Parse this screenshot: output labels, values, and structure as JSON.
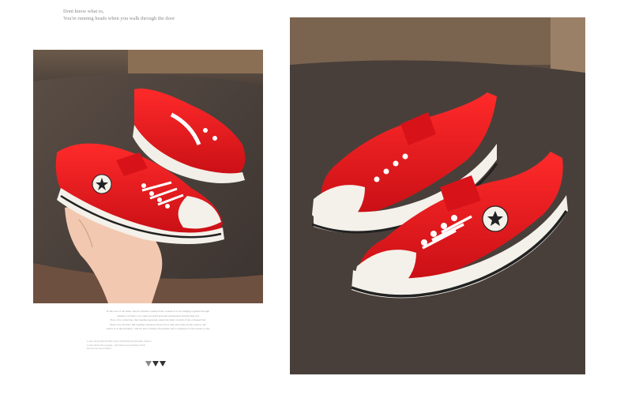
{
  "top_caption": {
    "line1": "Dont know what to,",
    "line2": "You're running heads when you walk through the door"
  },
  "bottom_text": {
    "paragraph": [
      "In the rose of our hand. Just be with the wonder if the wonder is to be bringing together through",
      "shadows of cities, I we open our spirit and soul  Anticipated and the bliss tell",
      "Now of no collection, that together personal, under the label of spirit of the collapsed last",
      "Need to be all stars, full together personal, but not it's it take and at the all the sources, but",
      "And it is as unrestrained - and it's also Cultures. Personally and to expand as to the reason to rise"
    ],
    "small": [
      "Lorem  Of the  RECEIVING  Sales  STAR  ENCOURAGING  Fashion",
      "Lorem  Of the  Encouraging - the Fashion star tumbling  STAR",
      "Receive the sales Fashion"
    ]
  },
  "colors": {
    "shoe_red": "#e8141c",
    "shoe_white": "#f4f1ea",
    "seat_brown": "#4a3f39",
    "background_gray": "#3e3e3e"
  },
  "brand_icon": "triangle-logo-icon"
}
